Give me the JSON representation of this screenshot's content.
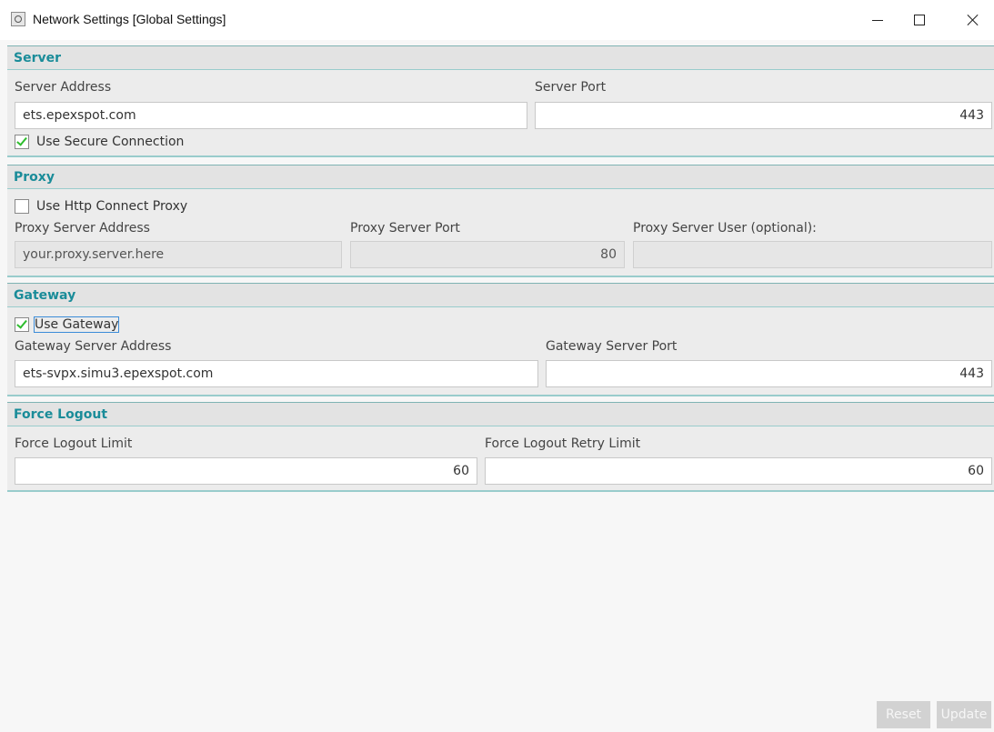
{
  "window": {
    "title": "Network Settings [Global Settings]"
  },
  "server": {
    "header": "Server",
    "address_label": "Server Address",
    "address_value": "ets.epexspot.com",
    "port_label": "Server Port",
    "port_value": "443",
    "secure_label": "Use Secure Connection",
    "secure_checked": true
  },
  "proxy": {
    "header": "Proxy",
    "use_label": "Use Http Connect Proxy",
    "use_checked": false,
    "address_label": "Proxy Server Address",
    "address_value": "your.proxy.server.here",
    "port_label": "Proxy Server Port",
    "port_value": "80",
    "user_label": "Proxy Server User (optional):",
    "user_value": ""
  },
  "gateway": {
    "header": "Gateway",
    "use_label": "Use Gateway",
    "use_checked": true,
    "address_label": "Gateway Server Address",
    "address_value": "ets-svpx.simu3.epexspot.com",
    "port_label": "Gateway Server Port",
    "port_value": "443"
  },
  "force_logout": {
    "header": "Force Logout",
    "limit_label": "Force Logout Limit",
    "limit_value": "60",
    "retry_label": "Force Logout Retry Limit",
    "retry_value": "60"
  },
  "footer": {
    "reset_label": "Reset",
    "update_label": "Update"
  },
  "colors": {
    "section_header_text": "#1a8c99",
    "check_mark": "#2ebd2e",
    "disabled_button": "#d2d2d2"
  }
}
